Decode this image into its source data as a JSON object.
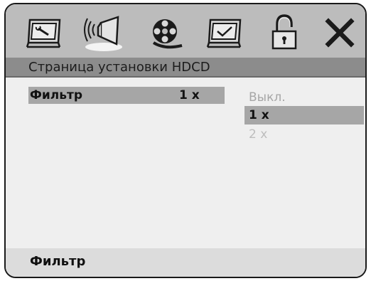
{
  "toolbar": {
    "icons": [
      "wrench-monitor-icon",
      "speaker-icon",
      "film-reel-icon",
      "checkmark-monitor-icon",
      "lock-icon",
      "close-icon"
    ],
    "active_index": 1
  },
  "page": {
    "title": "Страница установки HDCD"
  },
  "menu": {
    "item_label": "Фильтр",
    "item_value": "1 x"
  },
  "options": {
    "off_label": "Выкл.",
    "one_label": "1 x",
    "two_label": "2 x",
    "selected": "1 x"
  },
  "footer": {
    "hint": "Фильтр"
  },
  "colors": {
    "toolbar_bg": "#bcbcbc",
    "title_bar_bg": "#8c8c8c",
    "highlight": "#a6a6a6",
    "panel_bg": "#efefef",
    "footer_bg": "#dcdcdc",
    "disabled_text": "#a6a6a6"
  }
}
